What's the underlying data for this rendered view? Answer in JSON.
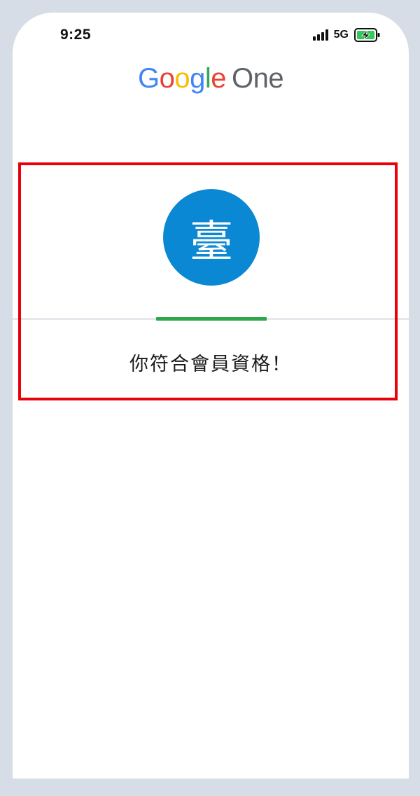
{
  "status_bar": {
    "time": "9:25",
    "network": "5G",
    "icons": [
      "signal-icon",
      "battery-charging-icon"
    ]
  },
  "logo": {
    "letters": [
      "G",
      "o",
      "o",
      "g",
      "l",
      "e"
    ],
    "product": "One"
  },
  "avatar": {
    "initial": "臺",
    "color": "#0B88D3"
  },
  "progress": {
    "color": "#2EA64A",
    "track_color": "#E5E7EC"
  },
  "message": "你符合會員資格！",
  "highlight_color": "#E8000B"
}
